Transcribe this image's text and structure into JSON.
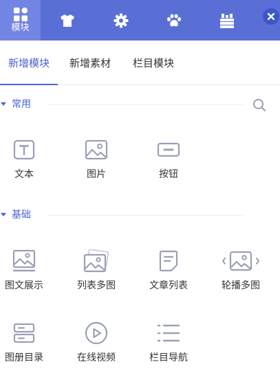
{
  "top_tabs": [
    {
      "label": "模块",
      "icon": "grid-icon",
      "active": true
    },
    {
      "label": "",
      "icon": "shirt-icon"
    },
    {
      "label": "",
      "icon": "gear-icon"
    },
    {
      "label": "",
      "icon": "paw-icon"
    },
    {
      "label": "",
      "icon": "stack-icon"
    }
  ],
  "close_icon": "close-icon",
  "sub_tabs": [
    {
      "label": "新增模块",
      "active": true
    },
    {
      "label": "新增素材"
    },
    {
      "label": "栏目模块"
    }
  ],
  "sections": {
    "common": {
      "title": "常用",
      "items": [
        {
          "label": "文本",
          "icon": "text-icon"
        },
        {
          "label": "图片",
          "icon": "image-icon"
        },
        {
          "label": "按钮",
          "icon": "button-icon"
        }
      ]
    },
    "basic": {
      "title": "基础",
      "items": [
        {
          "label": "图文展示",
          "icon": "image-text-icon"
        },
        {
          "label": "列表多图",
          "icon": "image-list-icon"
        },
        {
          "label": "文章列表",
          "icon": "article-list-icon"
        },
        {
          "label": "轮播多图",
          "icon": "carousel-icon"
        },
        {
          "label": "图册目录",
          "icon": "album-catalog-icon"
        },
        {
          "label": "在线视频",
          "icon": "video-icon"
        },
        {
          "label": "栏目导航",
          "icon": "menu-nav-icon"
        }
      ]
    }
  },
  "colors": {
    "topbar": "#5a6fd6",
    "topbar_active": "#7385e3",
    "accent": "#4a61d6",
    "icon_gray": "#9aa0b4"
  }
}
